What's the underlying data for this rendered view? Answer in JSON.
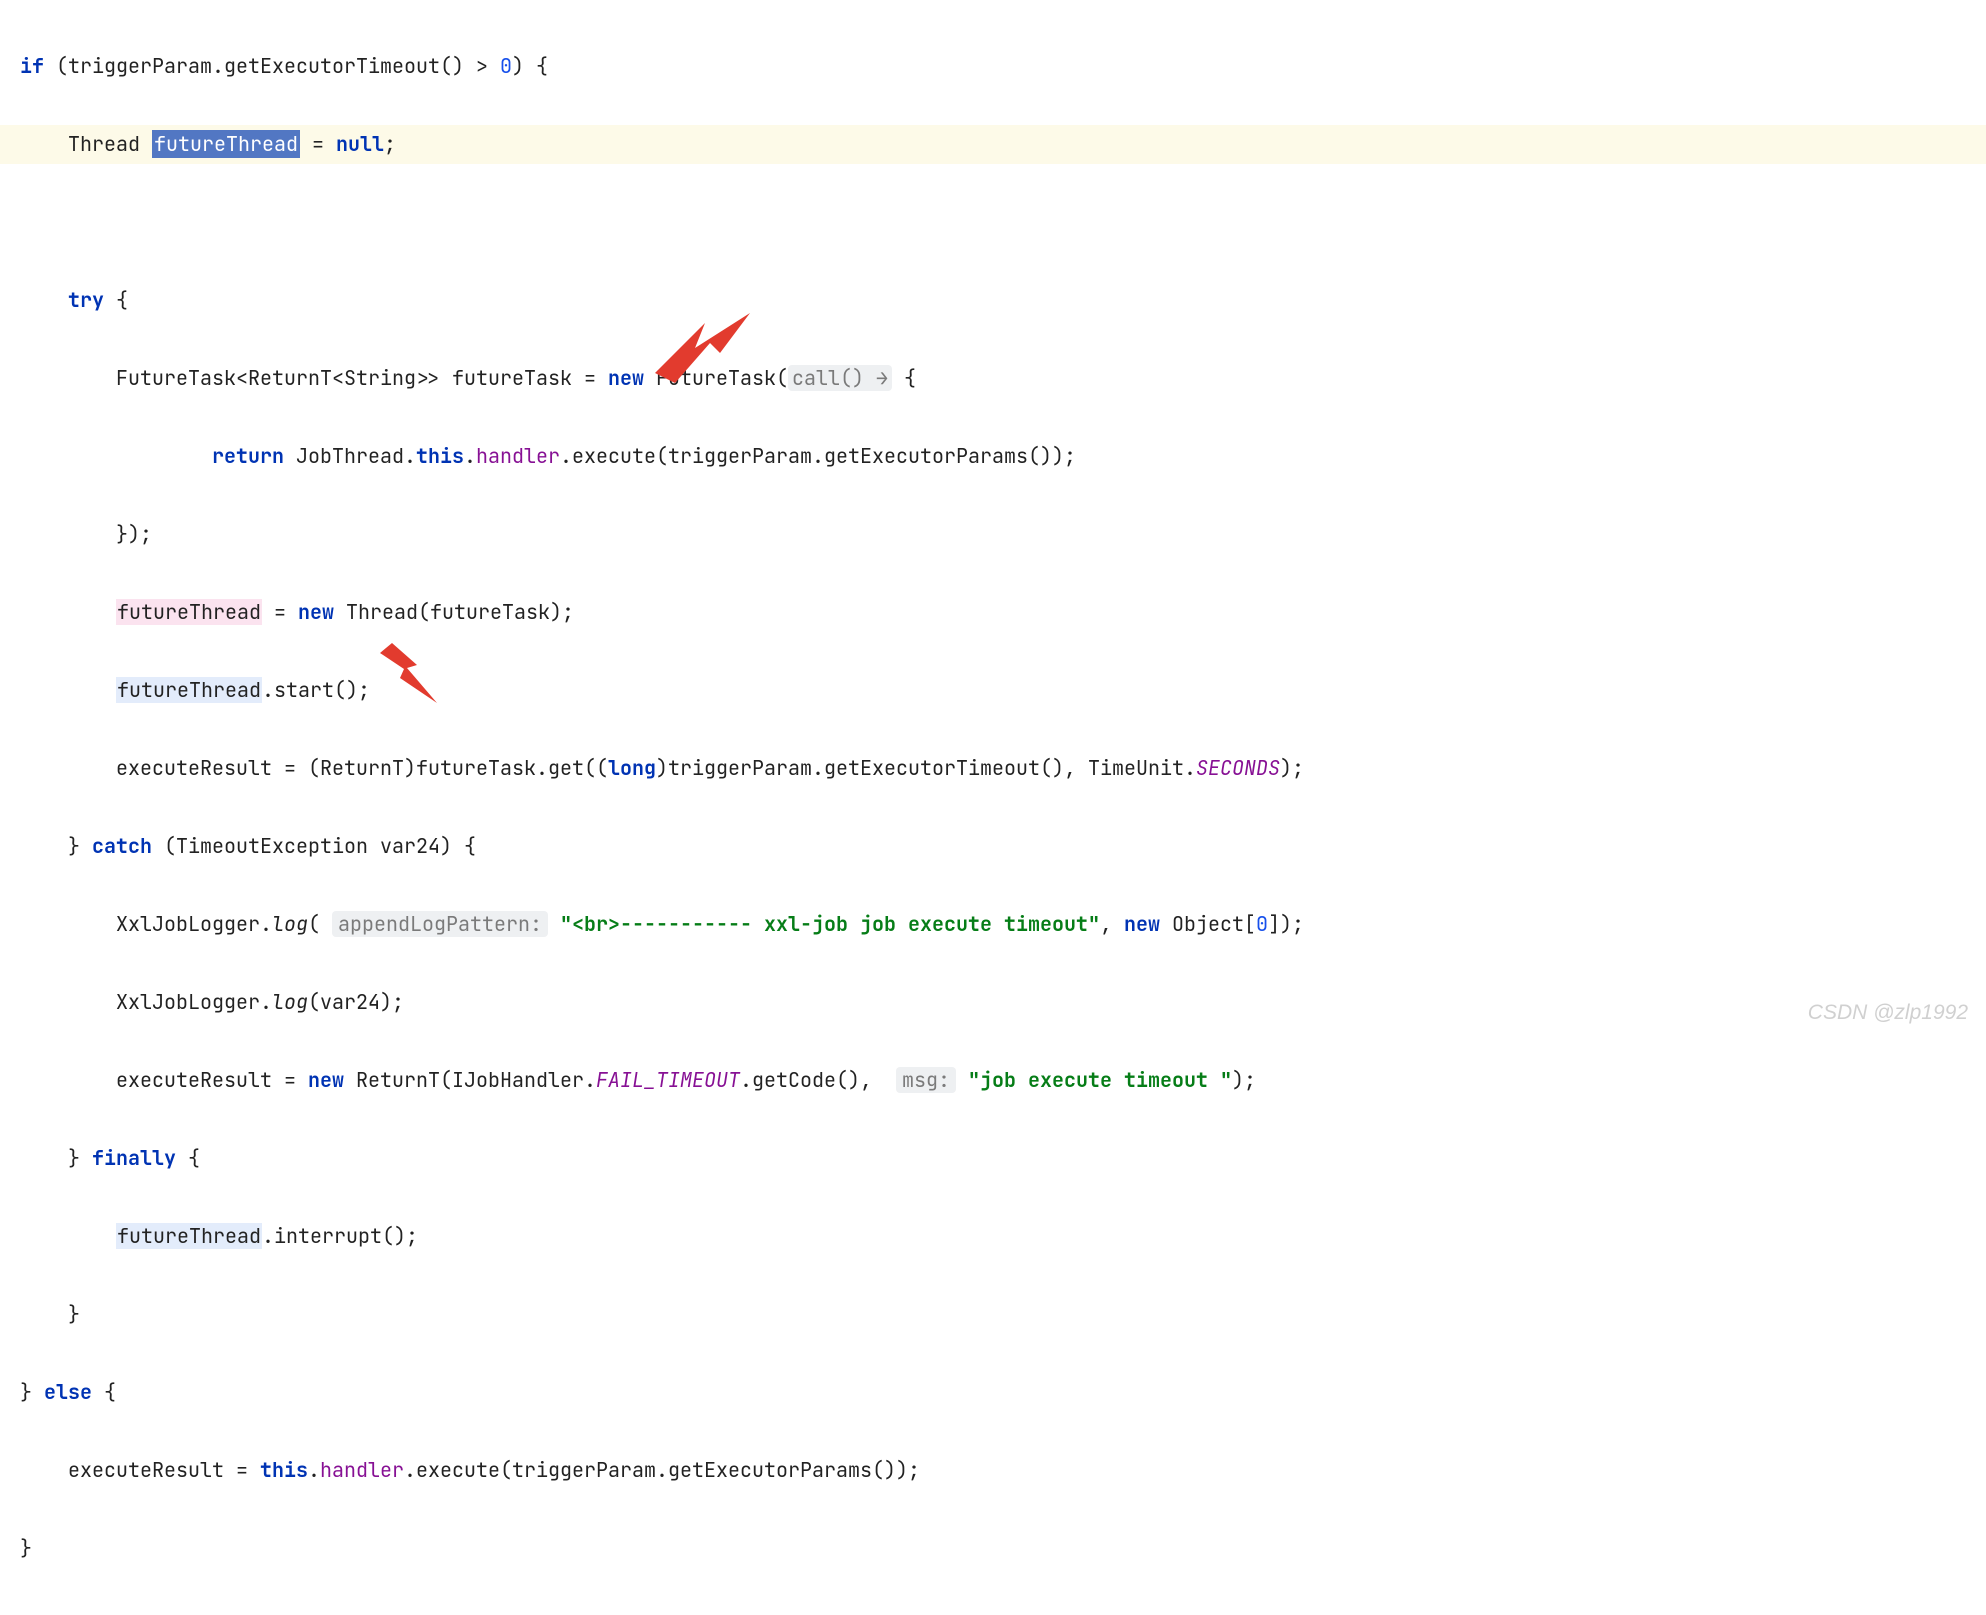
{
  "code": {
    "l1_if": "if",
    "l1_rest": " (triggerParam.getExecutorTimeout() > ",
    "l1_zero": "0",
    "l1_end": ") {",
    "l2_pre": "    Thread ",
    "l2_var": "futureThread",
    "l2_mid": " = ",
    "l2_null": "null",
    "l2_end": ";",
    "l3_try": "try",
    "l3_end": " {",
    "l4_pre": "        FutureTask<ReturnT<String>> futureTask = ",
    "l4_new": "new",
    "l4_mid": " FutureTask(",
    "l4_hint": "call() →",
    "l4_end": " {",
    "l5_pre": "                ",
    "l5_return": "return",
    "l5_mid1": " JobThread.",
    "l5_this": "this",
    "l5_mid2": ".",
    "l5_handler": "handler",
    "l5_mid3": ".execute(triggerParam.getExecutorParams());",
    "l6": "        });",
    "l7_pre": "        ",
    "l7_var": "futureThread",
    "l7_mid": " = ",
    "l7_new": "new",
    "l7_end": " Thread(futureTask);",
    "l8_pre": "        ",
    "l8_var": "futureThread",
    "l8_end": ".start();",
    "l9_pre": "        executeResult = (ReturnT)futureTask.get((",
    "l9_long": "long",
    "l9_mid": ")triggerParam.getExecutorTimeout(), TimeUnit.",
    "l9_seconds": "SECONDS",
    "l9_end": ");",
    "l10_pre": "    } ",
    "l10_catch": "catch",
    "l10_end": " (TimeoutException var24) {",
    "l11_pre": "        XxlJobLogger.",
    "l11_log": "log",
    "l11_mid1": "( ",
    "l11_hint": "appendLogPattern:",
    "l11_mid2": " ",
    "l11_str": "\"<br>----------- xxl-job job execute timeout\"",
    "l11_mid3": ", ",
    "l11_new": "new",
    "l11_mid4": " Object[",
    "l11_zero": "0",
    "l11_end": "]);",
    "l12_pre": "        XxlJobLogger.",
    "l12_log": "log",
    "l12_end": "(var24);",
    "l13_pre": "        executeResult = ",
    "l13_new": "new",
    "l13_mid1": " ReturnT(IJobHandler.",
    "l13_fail": "FAIL_TIMEOUT",
    "l13_mid2": ".getCode(),  ",
    "l13_hint": "msg:",
    "l13_mid3": " ",
    "l13_str": "\"job execute timeout \"",
    "l13_end": ");",
    "l14_pre": "    } ",
    "l14_finally": "finally",
    "l14_end": " {",
    "l15_pre": "        ",
    "l15_var": "futureThread",
    "l15_end": ".interrupt();",
    "l16": "    }",
    "l17_pre": "} ",
    "l17_else": "else",
    "l17_end": " {",
    "l18_pre": "    executeResult = ",
    "l18_this": "this",
    "l18_mid1": ".",
    "l18_handler": "handler",
    "l18_end": ".execute(triggerParam.getExecutorParams());",
    "l19": "}"
  },
  "watermark": "CSDN @zlp1992",
  "annotations": {
    "arrow1": "red-arrow",
    "arrow2": "red-arrow"
  }
}
